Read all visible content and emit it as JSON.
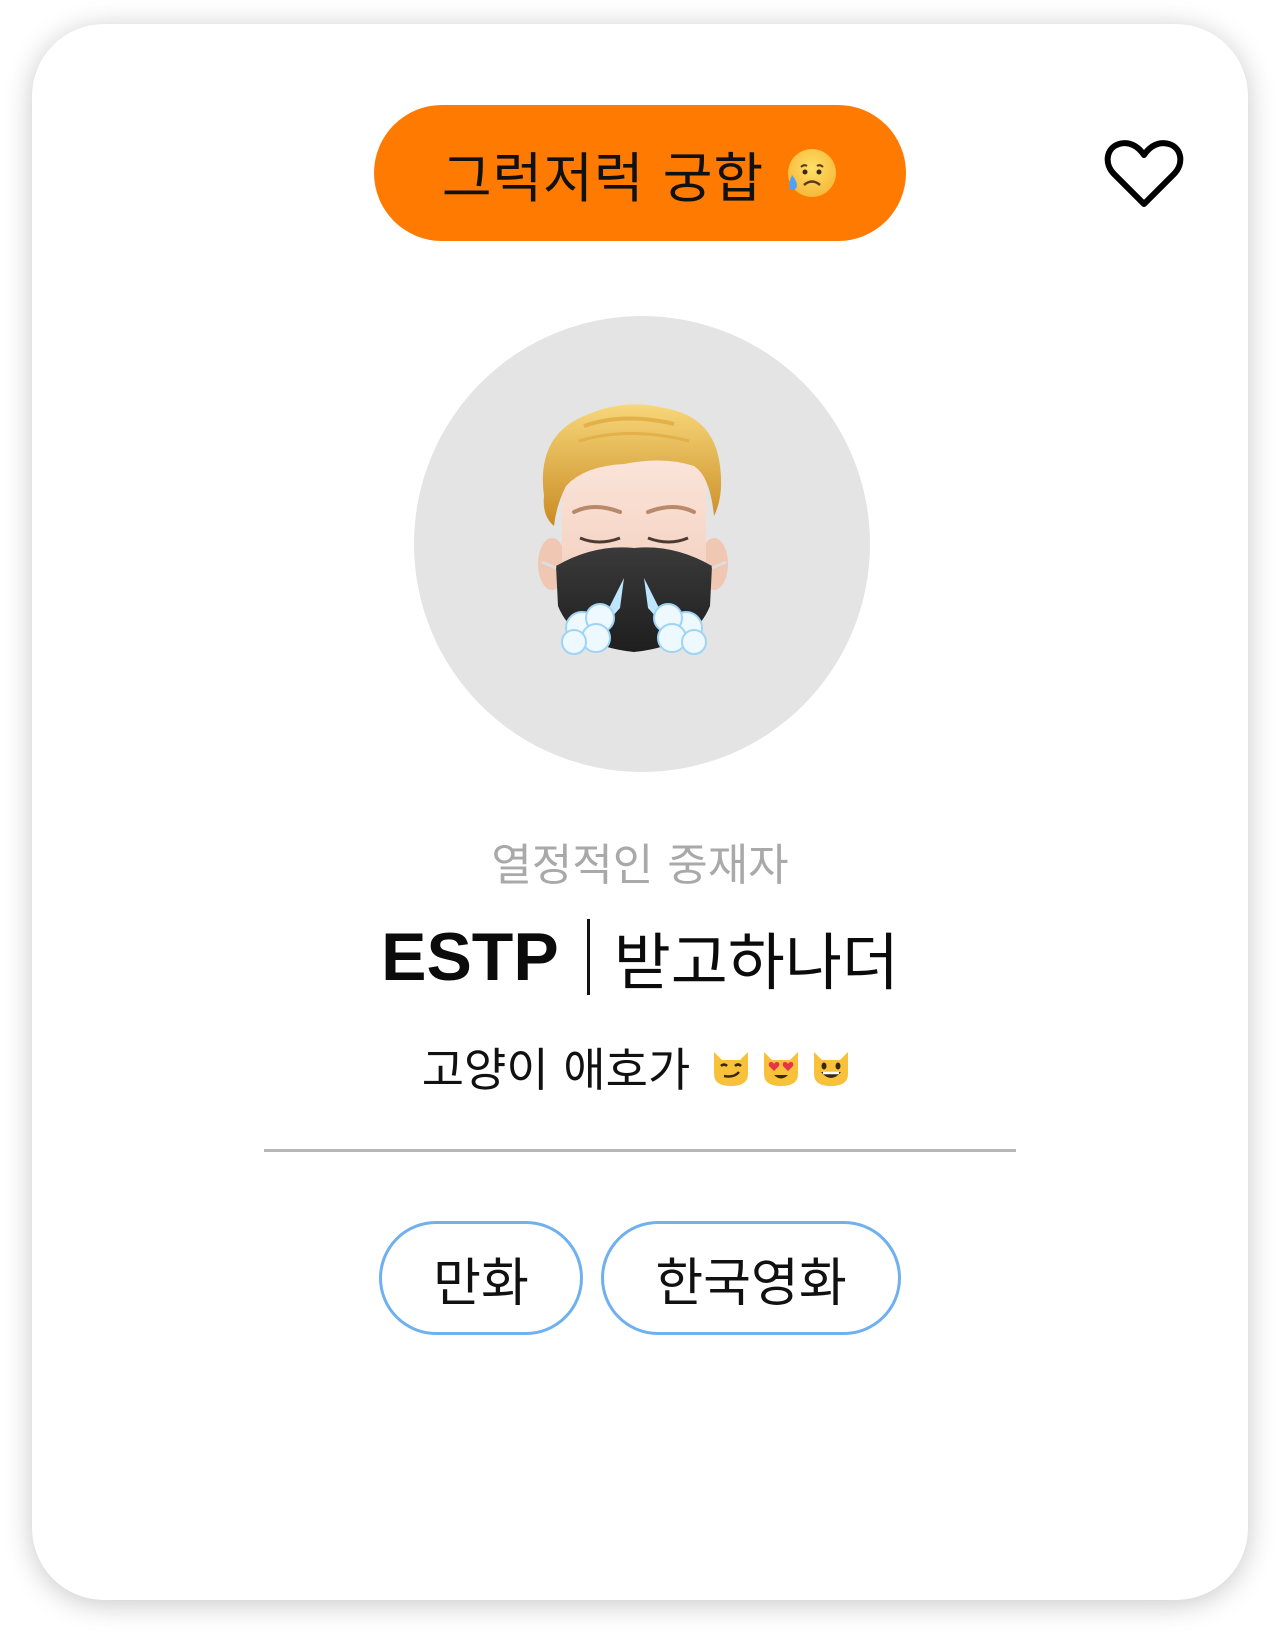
{
  "card": {
    "match_label": "그럭저럭 궁합",
    "match_emoji": "sad-but-relieved-face-icon",
    "favorite_icon": "heart-outline-icon",
    "avatar": "memoji-mask-steam-avatar",
    "subtitle": "열정적인 중재자",
    "mbti": "ESTP",
    "nickname": "받고하나더",
    "bio_text": "고양이 애호가",
    "bio_emojis": [
      "smirking-cat-icon",
      "heart-eyes-cat-icon",
      "grinning-cat-icon"
    ],
    "tags": [
      "만화",
      "한국영화"
    ]
  },
  "colors": {
    "accent": "#ff7a00",
    "tag_border": "#6fb0ef",
    "avatar_bg": "#e4e4e4",
    "subtitle": "#a9a9a9"
  }
}
